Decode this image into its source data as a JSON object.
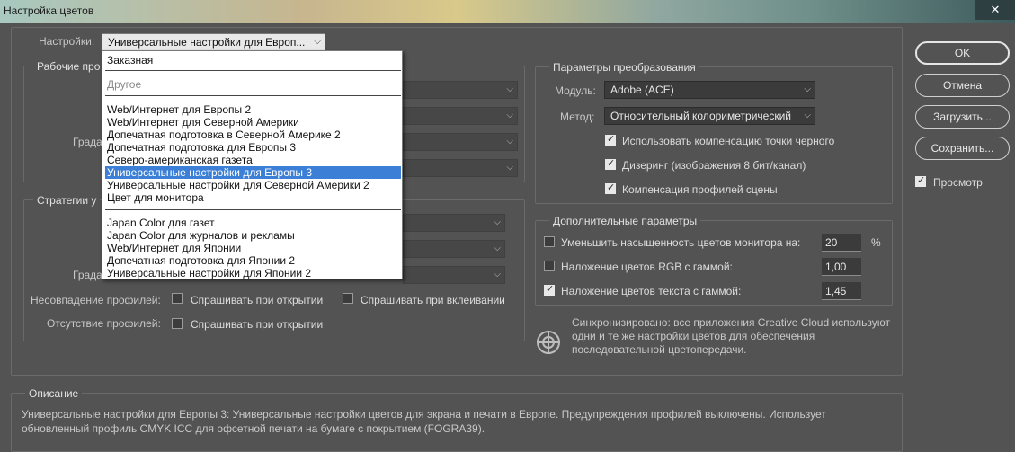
{
  "window": {
    "title": "Настройка цветов",
    "close_icon": "close-icon"
  },
  "settings": {
    "label": "Настройки:",
    "selected": "Универсальные настройки для Европ...",
    "dropdown": {
      "items": [
        {
          "label": "Заказная"
        },
        {
          "label": "Другое"
        },
        {
          "label": "Web/Интернет для Европы 2"
        },
        {
          "label": "Web/Интернет для Северной Америки"
        },
        {
          "label": "Допечатная подготовка в Северной Америке 2"
        },
        {
          "label": "Допечатная подготовка для Европы 3"
        },
        {
          "label": "Северо-американская газета"
        },
        {
          "label": "Универсальные настройки для Европы 3"
        },
        {
          "label": "Универсальные настройки для Северной Америки 2"
        },
        {
          "label": "Цвет для монитора"
        },
        {
          "label": "Japan Color для газет"
        },
        {
          "label": "Japan Color для журналов и рекламы"
        },
        {
          "label": "Web/Интернет для Японии"
        },
        {
          "label": "Допечатная подготовка для Японии 2"
        },
        {
          "label": "Универсальные настройки для Японии 2"
        }
      ]
    }
  },
  "working_spaces": {
    "legend": "Рабочие про",
    "gray_label": "Града"
  },
  "policies": {
    "legend": "Стратегии у",
    "gray_label": "Града",
    "mismatch_label": "Несовпадение профилей:",
    "ask_open": "Спрашивать при открытии",
    "ask_paste": "Спрашивать при вклеивании",
    "missing_label": "Отсутствие профилей:",
    "ask_open_missing": "Спрашивать при открытии"
  },
  "conversion": {
    "legend": "Параметры преобразования",
    "engine_label": "Модуль:",
    "engine_value": "Adobe (ACE)",
    "intent_label": "Метод:",
    "intent_value": "Относительный колориметрический",
    "bpc": "Использовать компенсацию точки черного",
    "dither": "Дизеринг (изображения 8 бит/канал)",
    "scene": "Компенсация профилей сцены"
  },
  "advanced": {
    "legend": "Дополнительные параметры",
    "desaturate_label": "Уменьшить насыщенность цветов монитора на:",
    "desaturate_value": "20",
    "desaturate_unit": "%",
    "blend_rgb_label": "Наложение цветов RGB с гаммой:",
    "blend_rgb_value": "1,00",
    "blend_text_label": "Наложение цветов текста с гаммой:",
    "blend_text_value": "1,45"
  },
  "sync": {
    "text": "Синхронизировано: все приложения Creative Cloud используют одни и те же настройки цветов для обеспечения последовательной цветопередачи.",
    "icon": "sync-target-icon"
  },
  "buttons": {
    "ok": "OK",
    "cancel": "Отмена",
    "load": "Загрузить...",
    "save": "Сохранить...",
    "preview": "Просмотр"
  },
  "description": {
    "legend": "Описание",
    "text": "Универсальные настройки для Европы 3:  Универсальные настройки цветов для экрана и печати в Европе. Предупреждения профилей выключены. Использует обновленный профиль CMYK ICC для офсетной печати на бумаге с покрытием (FOGRA39)."
  }
}
